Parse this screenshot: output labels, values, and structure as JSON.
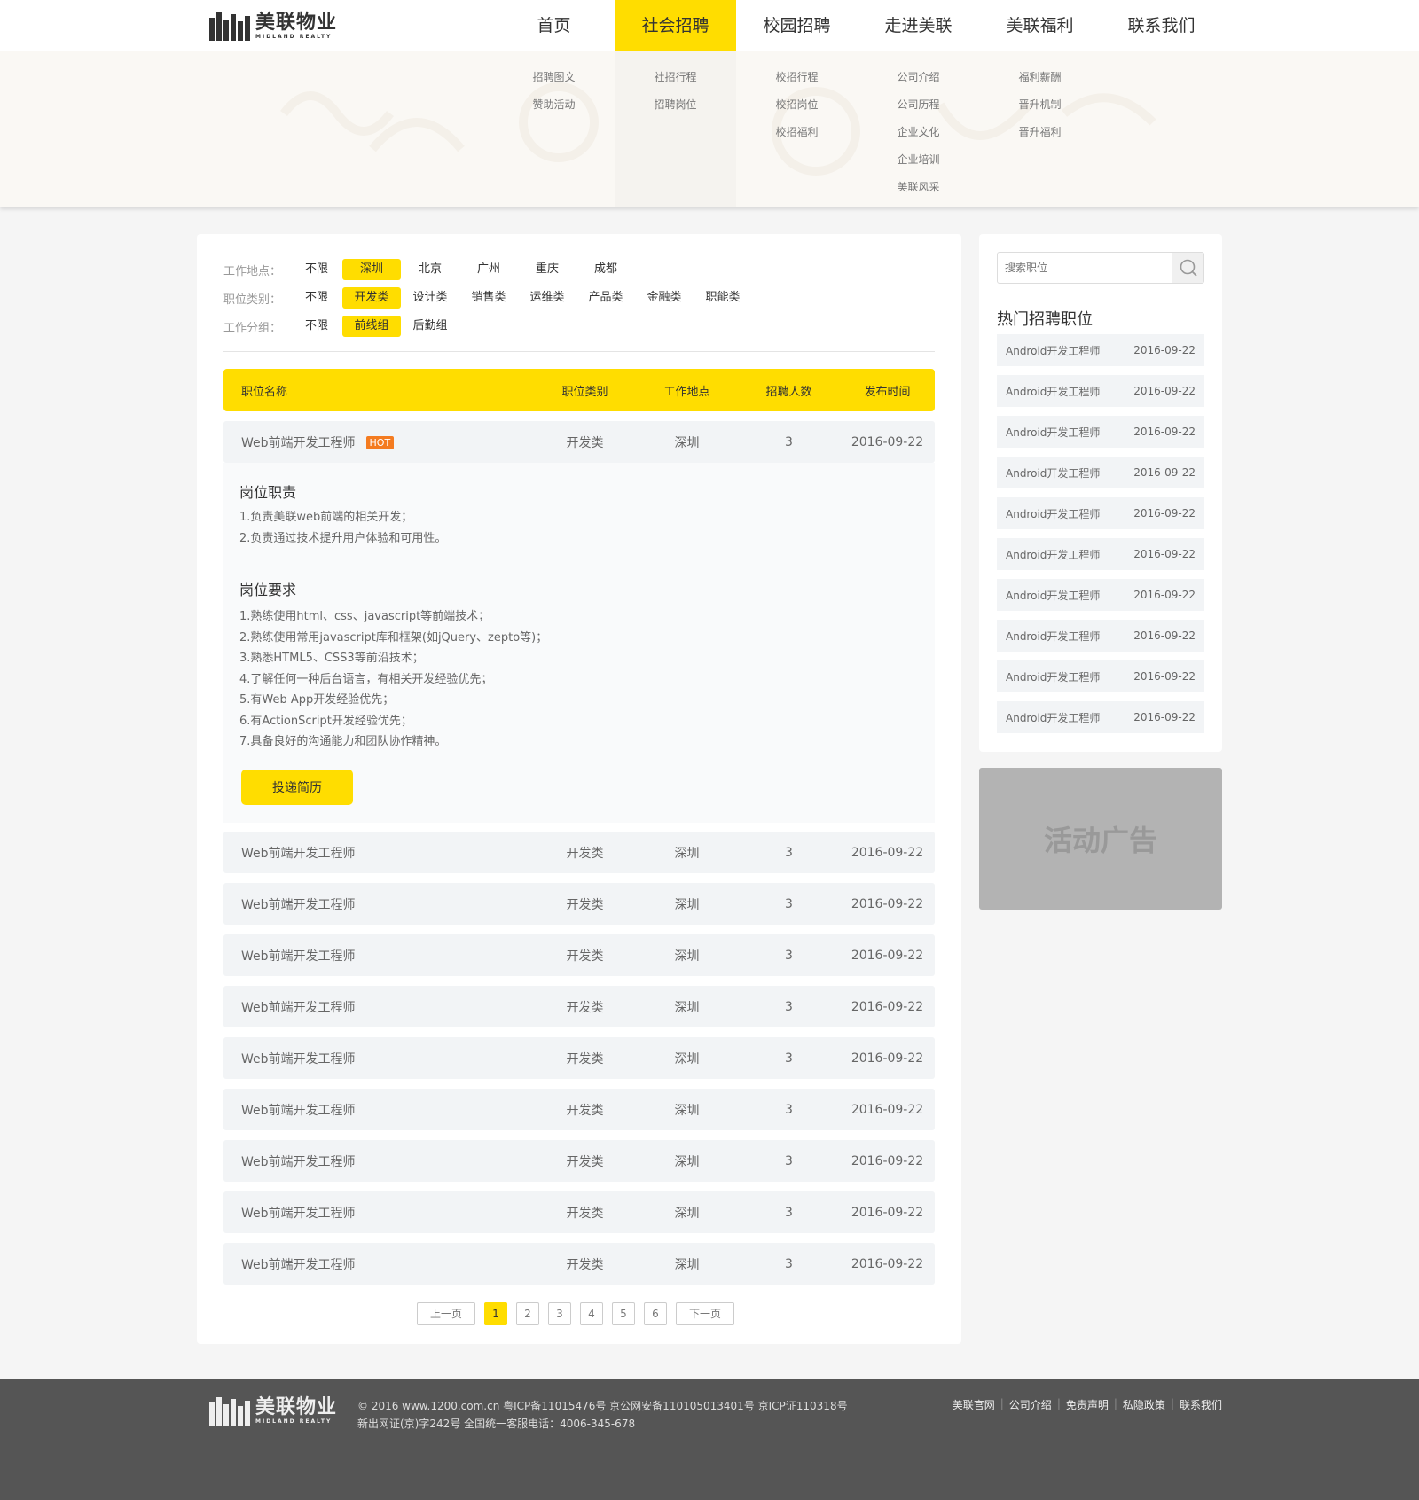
{
  "brand": {
    "cn": "美联物业",
    "en": "MIDLAND REALTY"
  },
  "nav": [
    "首页",
    "社会招聘",
    "校园招聘",
    "走进美联",
    "美联福利",
    "联系我们"
  ],
  "dropdown": [
    [
      "招聘图文",
      "赞助活动"
    ],
    [
      "社招行程",
      "招聘岗位"
    ],
    [
      "校招行程",
      "校招岗位",
      "校招福利"
    ],
    [
      "公司介绍",
      "公司历程",
      "企业文化",
      "企业培训",
      "美联风采"
    ],
    [
      "福利薪酬",
      "晋升机制",
      "晋升福利"
    ]
  ],
  "filters": {
    "location": {
      "label": "工作地点：",
      "options": [
        "不限",
        "深圳",
        "北京",
        "广州",
        "重庆",
        "成都"
      ]
    },
    "category": {
      "label": "职位类别：",
      "options": [
        "不限",
        "开发类",
        "设计类",
        "销售类",
        "运维类",
        "产品类",
        "金融类",
        "职能类"
      ]
    },
    "group": {
      "label": "工作分组：",
      "options": [
        "不限",
        "前线组",
        "后勤组"
      ]
    }
  },
  "table": {
    "headers": [
      "职位名称",
      "职位类别",
      "工作地点",
      "招聘人数",
      "发布时间"
    ],
    "hot_badge": "HOT",
    "rows": [
      [
        "Web前端开发工程师",
        "开发类",
        "深圳",
        "3",
        "2016-09-22"
      ],
      [
        "Web前端开发工程师",
        "开发类",
        "深圳",
        "3",
        "2016-09-22"
      ],
      [
        "Web前端开发工程师",
        "开发类",
        "深圳",
        "3",
        "2016-09-22"
      ],
      [
        "Web前端开发工程师",
        "开发类",
        "深圳",
        "3",
        "2016-09-22"
      ],
      [
        "Web前端开发工程师",
        "开发类",
        "深圳",
        "3",
        "2016-09-22"
      ],
      [
        "Web前端开发工程师",
        "开发类",
        "深圳",
        "3",
        "2016-09-22"
      ],
      [
        "Web前端开发工程师",
        "开发类",
        "深圳",
        "3",
        "2016-09-22"
      ],
      [
        "Web前端开发工程师",
        "开发类",
        "深圳",
        "3",
        "2016-09-22"
      ],
      [
        "Web前端开发工程师",
        "开发类",
        "深圳",
        "3",
        "2016-09-22"
      ],
      [
        "Web前端开发工程师",
        "开发类",
        "深圳",
        "3",
        "2016-09-22"
      ]
    ]
  },
  "detail": {
    "duty_title": "岗位职责",
    "duties": [
      "1.负责美联web前端的相关开发；",
      "2.负责通过技术提升用户体验和可用性。"
    ],
    "req_title": "岗位要求",
    "requirements": [
      "1.熟练使用html、css、javascript等前端技术；",
      "2.熟练使用常用javascript库和框架(如jQuery、zepto等)；",
      "3.熟悉HTML5、CSS3等前沿技术；",
      "4.了解任何一种后台语言，有相关开发经验优先；",
      "5.有Web App开发经验优先；",
      "6.有ActionScript开发经验优先；",
      "7.具备良好的沟通能力和团队协作精神。"
    ],
    "apply_label": "投递简历"
  },
  "pager": {
    "prev": "上一页",
    "pages": [
      "1",
      "2",
      "3",
      "4",
      "5",
      "6"
    ],
    "next": "下一页",
    "current": "1"
  },
  "sidebar": {
    "search_placeholder": "搜索职位",
    "title": "热门招聘职位",
    "items": [
      [
        "Android开发工程师",
        "2016-09-22"
      ],
      [
        "Android开发工程师",
        "2016-09-22"
      ],
      [
        "Android开发工程师",
        "2016-09-22"
      ],
      [
        "Android开发工程师",
        "2016-09-22"
      ],
      [
        "Android开发工程师",
        "2016-09-22"
      ],
      [
        "Android开发工程师",
        "2016-09-22"
      ],
      [
        "Android开发工程师",
        "2016-09-22"
      ],
      [
        "Android开发工程师",
        "2016-09-22"
      ],
      [
        "Android开发工程师",
        "2016-09-22"
      ],
      [
        "Android开发工程师",
        "2016-09-22"
      ]
    ],
    "ad": "活动广告"
  },
  "footer": {
    "copy1": "© 2016 www.1200.com.cn 粤ICP备11015476号 京公网安备110105013401号 京ICP证110318号",
    "copy2": "新出网证(京)字242号 全国统一客服电话：4006-345-678",
    "links": [
      "美联官网",
      "公司介绍",
      "免责声明",
      "私隐政策",
      "联系我们"
    ]
  },
  "colors": {
    "accent": "#ffdd00",
    "hot": "#f47b20",
    "footer": "#555555"
  }
}
